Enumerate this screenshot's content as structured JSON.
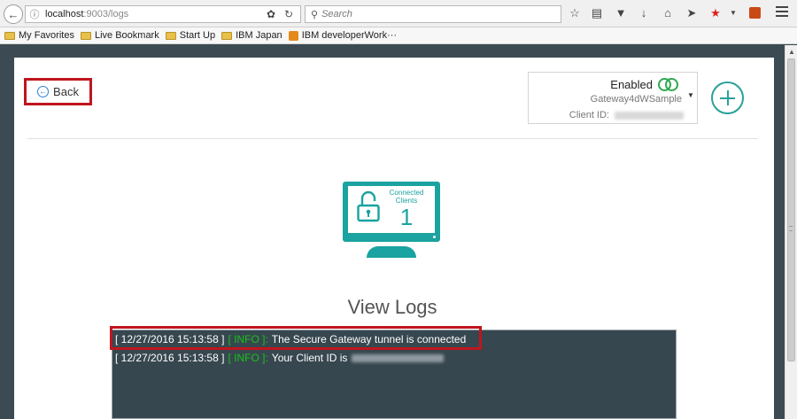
{
  "browser": {
    "url_host": "localhost",
    "url_path": ":9003/logs",
    "search_placeholder": "Search",
    "bookmarks": [
      {
        "label": "My Favorites"
      },
      {
        "label": "Live Bookmark"
      },
      {
        "label": "Start Up"
      },
      {
        "label": "IBM Japan"
      },
      {
        "label": "IBM developerWork···"
      }
    ]
  },
  "page": {
    "back_label": "Back",
    "gateway": {
      "status": "Enabled",
      "name": "Gateway4dWSample",
      "client_id_label": "Client ID:"
    },
    "monitor": {
      "label": "Connected Clients",
      "count": "1"
    },
    "title": "View Logs",
    "logs": [
      {
        "timestamp": "[ 12/27/2016 15:13:58 ]",
        "level": "[ INFO ]:",
        "message": "The Secure Gateway tunnel is connected"
      },
      {
        "timestamp": "[ 12/27/2016 15:13:58 ]",
        "level": "[ INFO ]:",
        "message": "Your Client ID is"
      }
    ]
  },
  "colors": {
    "accent": "#1aa3a0",
    "info_level": "#19c31b",
    "highlight": "#c0151d",
    "log_background": "#37474f",
    "page_background": "#3c4a53"
  }
}
